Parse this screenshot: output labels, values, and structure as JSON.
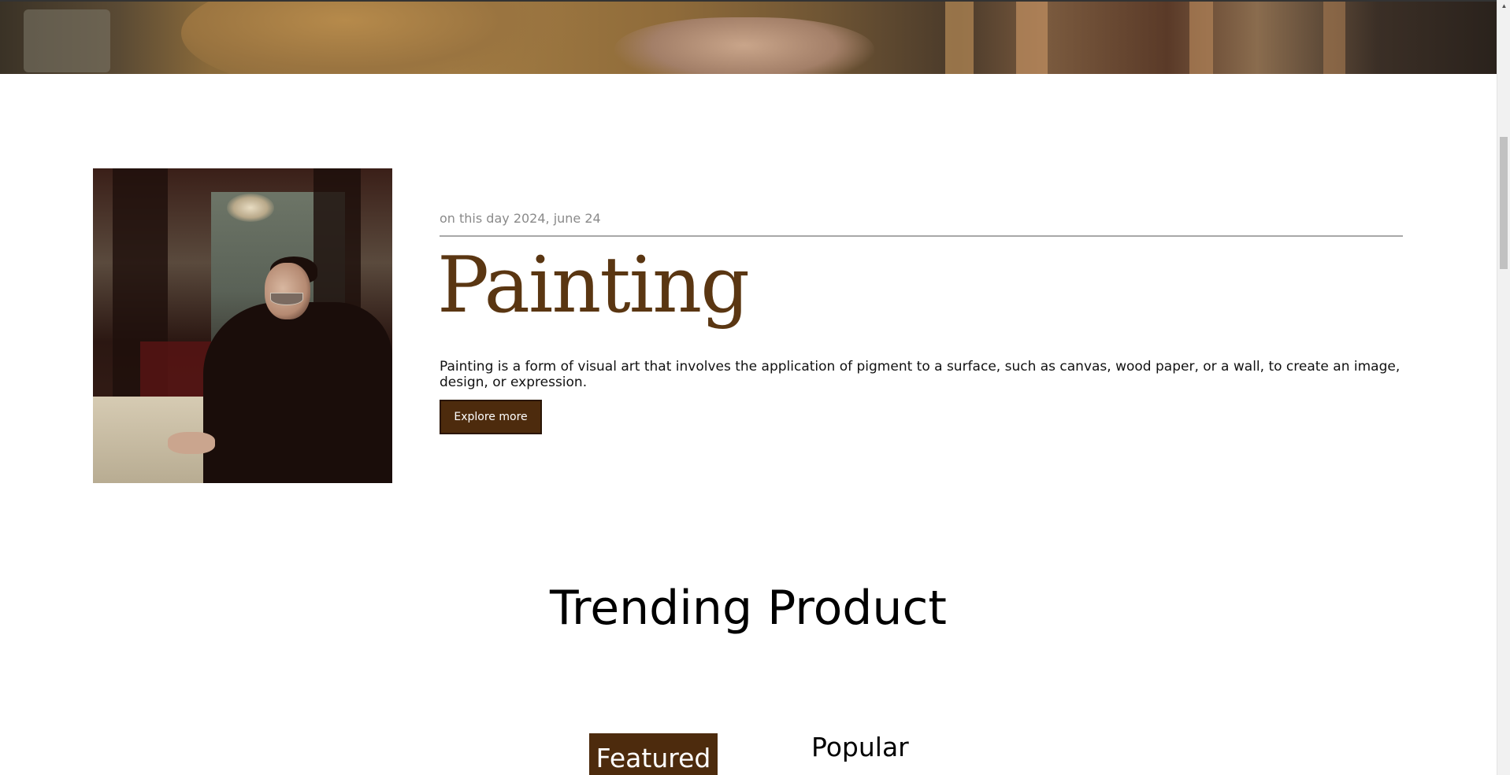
{
  "hero": {
    "image_alt": "artist-studio-photo"
  },
  "feature": {
    "image_alt": "painting-of-man-with-glass",
    "date": "on this day 2024, june 24",
    "title": "Painting",
    "description": "Painting is a form of visual art that involves the application of pigment to a surface, such as canvas, wood paper, or a wall, to create an image, design, or expression.",
    "button_label": "Explore more"
  },
  "trending": {
    "title": "Trending Product",
    "tabs": [
      {
        "label": "Featured",
        "active": true
      },
      {
        "label": "Popular",
        "active": false
      }
    ]
  },
  "colors": {
    "brand_brown": "#4d2b0d",
    "title_brown": "#5a3612"
  },
  "scrollbar": {
    "up_arrow": "▲"
  }
}
